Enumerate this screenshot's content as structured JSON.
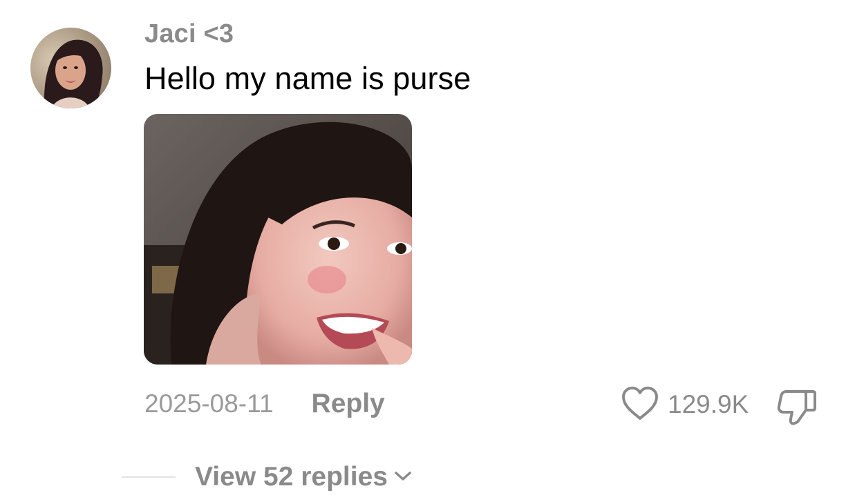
{
  "comment": {
    "username": "Jaci <3",
    "text": "Hello my name is purse",
    "avatar_icon": "user-avatar-photo",
    "attached_image": "photo-of-smiling-girl"
  },
  "meta": {
    "date": "2025-08-11",
    "reply_label": "Reply",
    "like_count": "129.9K",
    "like_icon": "heart-outline-icon",
    "dislike_icon": "thumbs-down-outline-icon"
  },
  "replies": {
    "label": "View 52 replies",
    "icon": "chevron-down-icon"
  },
  "colors": {
    "muted_text": "#8a8a8a",
    "date_text": "#9a9a9a",
    "primary_text": "#000000",
    "divider": "#e3e3e3"
  }
}
